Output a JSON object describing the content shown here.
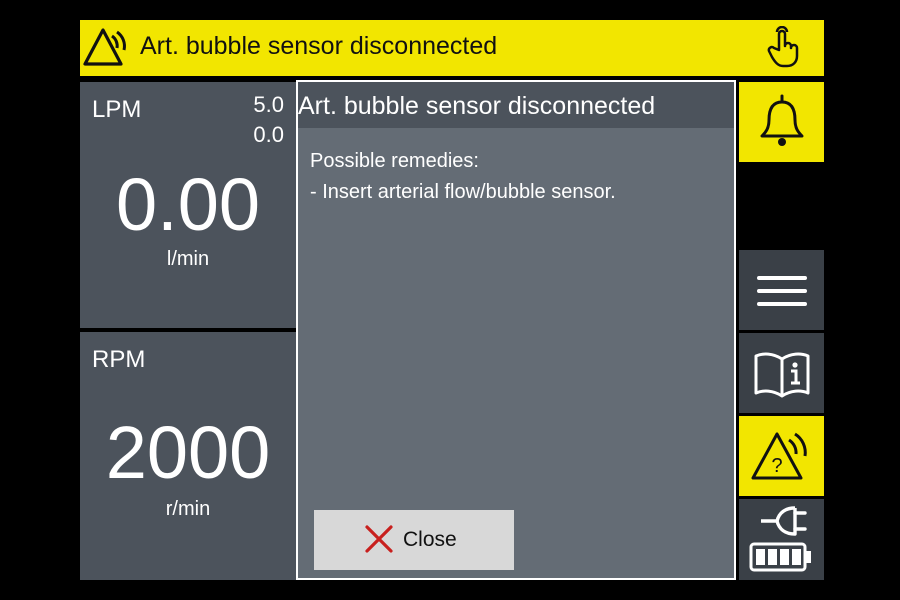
{
  "alarm_banner": {
    "title": "Art. bubble sensor disconnected",
    "color": "#f2e600"
  },
  "flow_panel": {
    "label": "LPM",
    "upper_limit": "5.0",
    "lower_limit": "0.0",
    "value": "0.00",
    "unit": "l/min"
  },
  "speed_panel": {
    "label": "RPM",
    "value": "2000",
    "unit": "r/min"
  },
  "dialog": {
    "title": "Art. bubble sensor disconnected",
    "remedies_heading": "Possible remedies:",
    "remedy_1": "- Insert arterial flow/bubble sensor.",
    "close_label": "Close"
  },
  "side_buttons": [
    {
      "icon": "bell-icon"
    },
    {
      "icon": "menu-icon"
    },
    {
      "icon": "book-info-icon"
    },
    {
      "icon": "alarm-question-icon"
    },
    {
      "icon": "plug-battery-icon"
    }
  ],
  "colors": {
    "accent_yellow": "#f2e600",
    "panel_gray": "#4c535c",
    "dialog_gray": "#646c75",
    "close_x_red": "#c8201e"
  }
}
